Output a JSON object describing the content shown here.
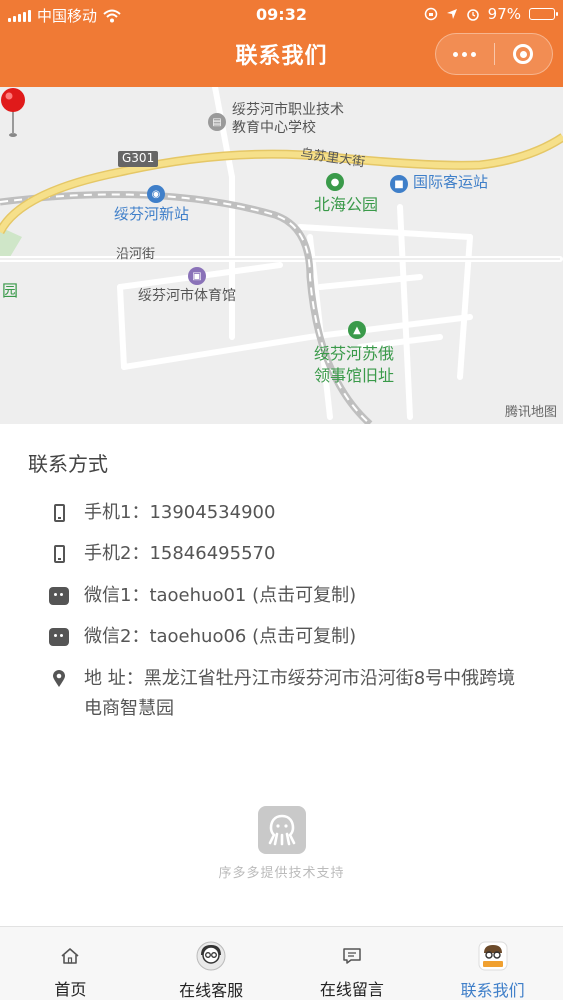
{
  "status_bar": {
    "carrier": "中国移动",
    "time": "09:32",
    "battery": "97%",
    "battery_level": 0.97
  },
  "header": {
    "title": "联系我们",
    "more_icon": "more-dots-icon",
    "close_icon": "target-close-icon"
  },
  "map": {
    "labels": {
      "school": "绥芬河市职业技术\n教育中心学校",
      "highway": "G301",
      "wusuli": "乌苏里大街",
      "station_intl": "国际客运站",
      "beihai": "北海公园",
      "new_station": "绥芬河新站",
      "yanhe": "沿河街",
      "stadium": "绥芬河市体育馆",
      "park_left": "园",
      "consulate": "绥芬河苏俄\n领事馆旧址",
      "provider": "腾讯地图"
    }
  },
  "contact": {
    "section_title": "联系方式",
    "items": [
      {
        "icon": "phone-icon",
        "text": "手机1：13904534900"
      },
      {
        "icon": "phone-icon",
        "text": "手机2：15846495570"
      },
      {
        "icon": "wechat-icon",
        "text": "微信1：taoehuo01 (点击可复制)"
      },
      {
        "icon": "wechat-icon",
        "text": "微信2：taoehuo06 (点击可复制)"
      },
      {
        "icon": "location-icon",
        "text": "地 址：黑龙江省牡丹江市绥芬河市沿河街8号中俄跨境电商智慧园"
      }
    ]
  },
  "brand": {
    "slogan": "序多多提供技术支持"
  },
  "tabbar": {
    "tabs": [
      {
        "label": "首页",
        "icon": "home-icon",
        "active": false
      },
      {
        "label": "在线客服",
        "icon": "customer-service-icon",
        "active": false
      },
      {
        "label": "在线留言",
        "icon": "message-icon",
        "active": false
      },
      {
        "label": "联系我们",
        "icon": "contact-logo-icon",
        "active": true
      }
    ]
  },
  "colors": {
    "primary": "#f07a35",
    "active_tab": "#3f7fc9",
    "park_green": "#3a9a4a",
    "road_yellow": "#f3d77a"
  }
}
